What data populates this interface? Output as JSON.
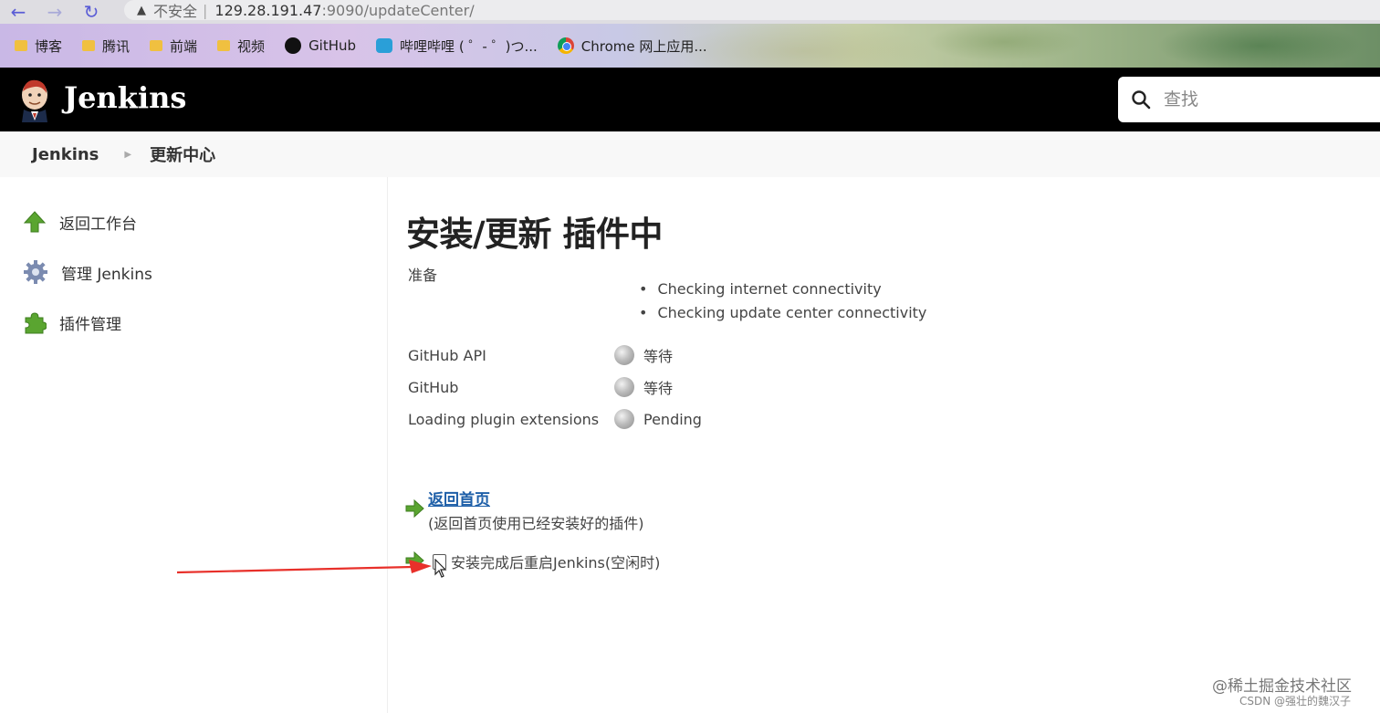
{
  "browser": {
    "security_label": "不安全",
    "url_host": "129.28.191.47",
    "url_path": ":9090/updateCenter/",
    "bookmarks": [
      {
        "label": "博客",
        "icon": "folder-icon"
      },
      {
        "label": "腾讯",
        "icon": "folder-icon"
      },
      {
        "label": "前端",
        "icon": "folder-icon"
      },
      {
        "label": "视频",
        "icon": "folder-icon"
      },
      {
        "label": "GitHub",
        "icon": "github-icon"
      },
      {
        "label": "哔哩哔哩 ( ゜- ゜)つ...",
        "icon": "bilibili-icon"
      },
      {
        "label": "Chrome 网上应用...",
        "icon": "chrome-icon"
      }
    ]
  },
  "header": {
    "title": "Jenkins",
    "search_placeholder": "查找"
  },
  "breadcrumb": {
    "root": "Jenkins",
    "current": "更新中心"
  },
  "sidebar": {
    "items": [
      {
        "label": "返回工作台",
        "icon": "up-arrow-icon"
      },
      {
        "label": "管理 Jenkins",
        "icon": "gear-icon"
      },
      {
        "label": "插件管理",
        "icon": "puzzle-icon"
      }
    ]
  },
  "main": {
    "title": "安装/更新 插件中",
    "prep_label": "准备",
    "checks": [
      "Checking internet connectivity",
      "Checking update center connectivity"
    ],
    "statuses": [
      {
        "name": "GitHub API",
        "status": "等待"
      },
      {
        "name": "GitHub",
        "status": "等待"
      },
      {
        "name": "Loading plugin extensions",
        "status": "Pending"
      }
    ],
    "back_link": "返回首页",
    "back_desc": "(返回首页使用已经安装好的插件)",
    "restart_label": "安装完成后重启Jenkins(空闲时)"
  },
  "watermark": {
    "line1": "@稀土掘金技术社区",
    "line2": "CSDN @强壮的魏汉子"
  },
  "colors": {
    "header_bg": "#000000",
    "link": "#1e5fa8",
    "annotation_arrow": "#e8302a",
    "icon_green": "#5aa530"
  }
}
